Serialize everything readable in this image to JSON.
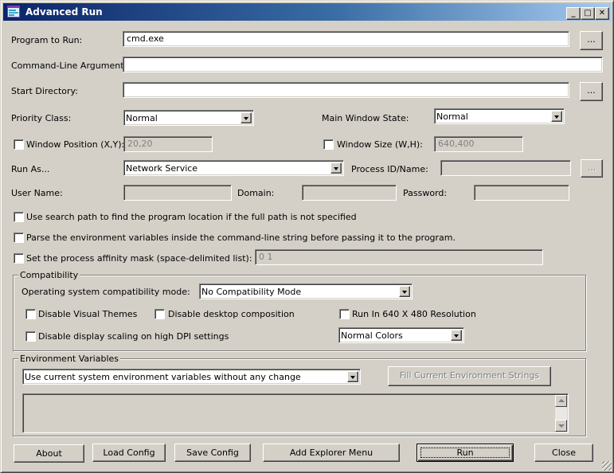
{
  "window": {
    "title": "Advanced Run",
    "minimize_label": "_",
    "maximize_label": "□",
    "close_label": "✕"
  },
  "program": {
    "label": "Program to Run:",
    "value": "cmd.exe",
    "browse_label": "..."
  },
  "arguments": {
    "label": "Command-Line Arguments:",
    "value": ""
  },
  "start_dir": {
    "label": "Start Directory:",
    "value": "",
    "browse_label": "..."
  },
  "priority": {
    "label": "Priority Class:",
    "selected": "Normal"
  },
  "main_window_state": {
    "label": "Main Window State:",
    "selected": "Normal"
  },
  "window_position": {
    "label": "Window Position (X,Y):",
    "checked": false,
    "value": "20,20"
  },
  "window_size": {
    "label": "Window Size (W,H):",
    "checked": false,
    "value": "640,400"
  },
  "run_as": {
    "label": "Run As...",
    "selected": "Network Service"
  },
  "process": {
    "label": "Process ID/Name:",
    "value": "",
    "browse_label": "..."
  },
  "user_name": {
    "label": "User Name:",
    "value": ""
  },
  "domain": {
    "label": "Domain:",
    "value": ""
  },
  "password": {
    "label": "Password:",
    "value": ""
  },
  "options": {
    "search_path": {
      "label": "Use search path to find the program location if the full path is not specified",
      "checked": false
    },
    "parse_env": {
      "label": "Parse the environment variables inside the command-line string before passing it to the program.",
      "checked": false
    },
    "affinity": {
      "label": "Set the process affinity mask (space-delimited list):",
      "checked": false,
      "value": "0 1"
    }
  },
  "compatibility": {
    "title": "Compatibility",
    "os_mode_label": "Operating system compatibility mode:",
    "os_mode_selected": "No Compatibility Mode",
    "disable_visual_themes": {
      "label": "Disable Visual Themes",
      "checked": false
    },
    "disable_desktop_composition": {
      "label": "Disable desktop composition",
      "checked": false
    },
    "run_640x480": {
      "label": "Run In 640 X 480 Resolution",
      "checked": false
    },
    "disable_dpi_scaling": {
      "label": "Disable display scaling on high DPI settings",
      "checked": false
    },
    "colors_selected": "Normal Colors"
  },
  "environment": {
    "title": "Environment Variables",
    "mode_selected": "Use current system environment variables without any change",
    "fill_button": "Fill Current Environment Strings",
    "strings": ""
  },
  "buttons": {
    "about": "About",
    "load_config": "Load Config",
    "save_config": "Save Config",
    "add_explorer_menu": "Add Explorer Menu",
    "run": "Run",
    "close": "Close"
  }
}
